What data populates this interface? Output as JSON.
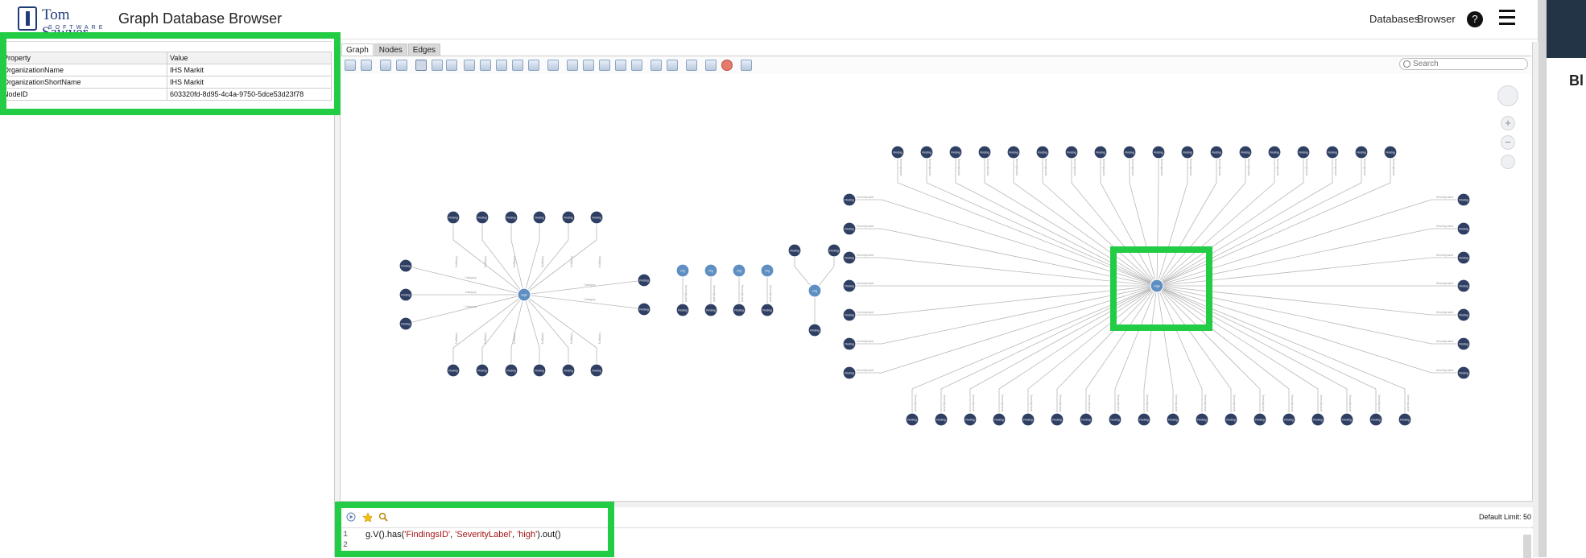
{
  "header": {
    "logo_brand": "Tom Sawyer",
    "logo_sub": "SOFTWARE",
    "title": "Graph Database Browser",
    "nav": [
      "Databases",
      "Browser"
    ],
    "help_label": "?"
  },
  "right_panel": {
    "text_fragment": "Bl"
  },
  "properties": {
    "headers": [
      "Property",
      "Value"
    ],
    "rows": [
      [
        "OrganizationName",
        "IHS Markit"
      ],
      [
        "OrganizationShortName",
        "IHS Markit"
      ],
      [
        "NodeID",
        "603320fd-8d95-4c4a-9750-5dce53d23f78"
      ]
    ]
  },
  "tabs": [
    "Graph",
    "Nodes",
    "Edges"
  ],
  "search": {
    "placeholder": "Search"
  },
  "graph": {
    "node_labels": {
      "finding": "Finding",
      "org": "Org",
      "center": "High"
    },
    "edge_labels": {
      "category": "Category",
      "severity": "SeverityLabel"
    },
    "colors": {
      "dark_node": "#2f3f63",
      "light_node": "#5f8fc2",
      "edge": "#b8b8b8"
    }
  },
  "query": {
    "default_limit": "Default Limit: 50",
    "line_numbers": [
      "1",
      "2"
    ],
    "code": {
      "prefix": "g.V().has(",
      "arg1": "'FindingsID'",
      "arg2": "'SeverityLabel'",
      "arg3": "'high'",
      "suffix": ").out()"
    }
  },
  "colors": {
    "highlight": "#22cc44",
    "accent_dark": "#243447"
  }
}
